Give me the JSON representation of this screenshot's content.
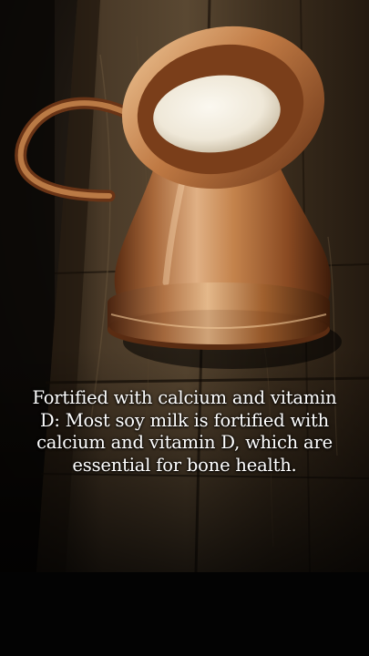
{
  "scene": {
    "subject": "copper-pitcher-with-milk",
    "colors": {
      "copper_light": "#d8a874",
      "copper_mid": "#a8683a",
      "copper_dark": "#4a2410",
      "milk": "#f3eee2",
      "wood_dark": "#1c140c",
      "wood_mid": "#4a3a28",
      "background": "#050403",
      "caption_text": "#ffffff"
    }
  },
  "caption": {
    "text": "Fortified with calcium and vitamin D: Most soy milk is fortified with calcium and vitamin D, which are essential for bone health."
  }
}
